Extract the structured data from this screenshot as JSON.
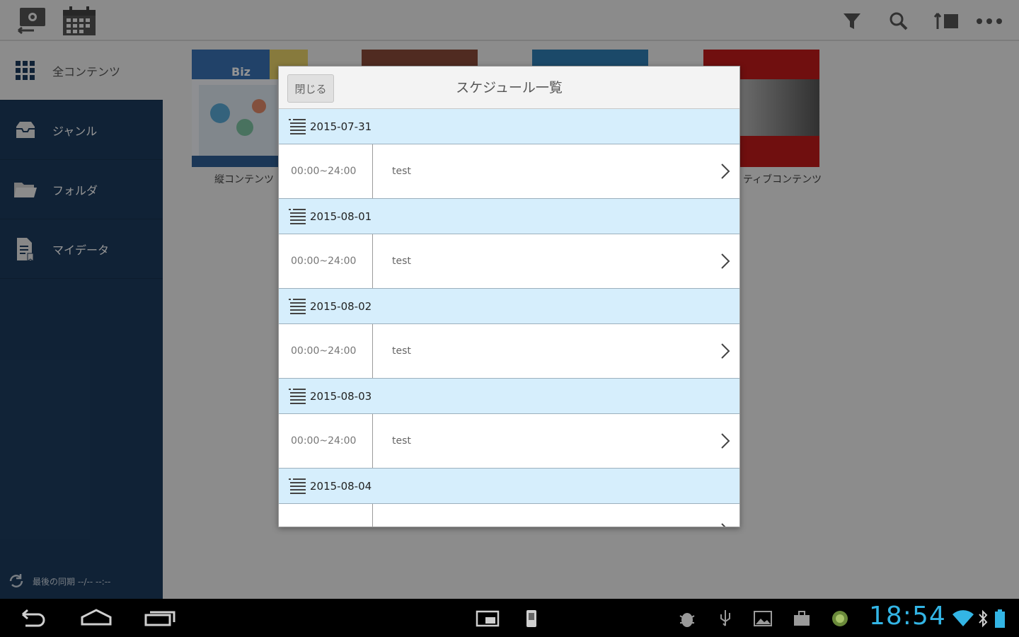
{
  "sidebar": {
    "all_contents": "全コンテンツ",
    "items": [
      {
        "label": "ジャンル",
        "icon": "inbox-icon"
      },
      {
        "label": "フォルダ",
        "icon": "folder-icon"
      },
      {
        "label": "マイデータ",
        "icon": "mydata-icon"
      }
    ],
    "last_sync": "最後の同期 --/-- --:--"
  },
  "content": {
    "thumbs": [
      {
        "caption": "縦コンテンツ"
      },
      {
        "caption": "ティブコンテンツ"
      }
    ],
    "thumb_badge": "Biz"
  },
  "modal": {
    "title": "スケジュール一覧",
    "close_label": "閉じる",
    "days": [
      {
        "date": "2015-07-31",
        "events": [
          {
            "time": "00:00~24:00",
            "title": "test"
          }
        ]
      },
      {
        "date": "2015-08-01",
        "events": [
          {
            "time": "00:00~24:00",
            "title": "test"
          }
        ]
      },
      {
        "date": "2015-08-02",
        "events": [
          {
            "time": "00:00~24:00",
            "title": "test"
          }
        ]
      },
      {
        "date": "2015-08-03",
        "events": [
          {
            "time": "00:00~24:00",
            "title": "test"
          }
        ]
      },
      {
        "date": "2015-08-04",
        "events": [
          {
            "time": "",
            "title": ""
          }
        ]
      }
    ]
  },
  "statusbar": {
    "clock": "18:54"
  },
  "colors": {
    "sidebar_bg": "#1d3c5e",
    "date_row_bg": "#d6eefc",
    "clock": "#33b5e5"
  }
}
